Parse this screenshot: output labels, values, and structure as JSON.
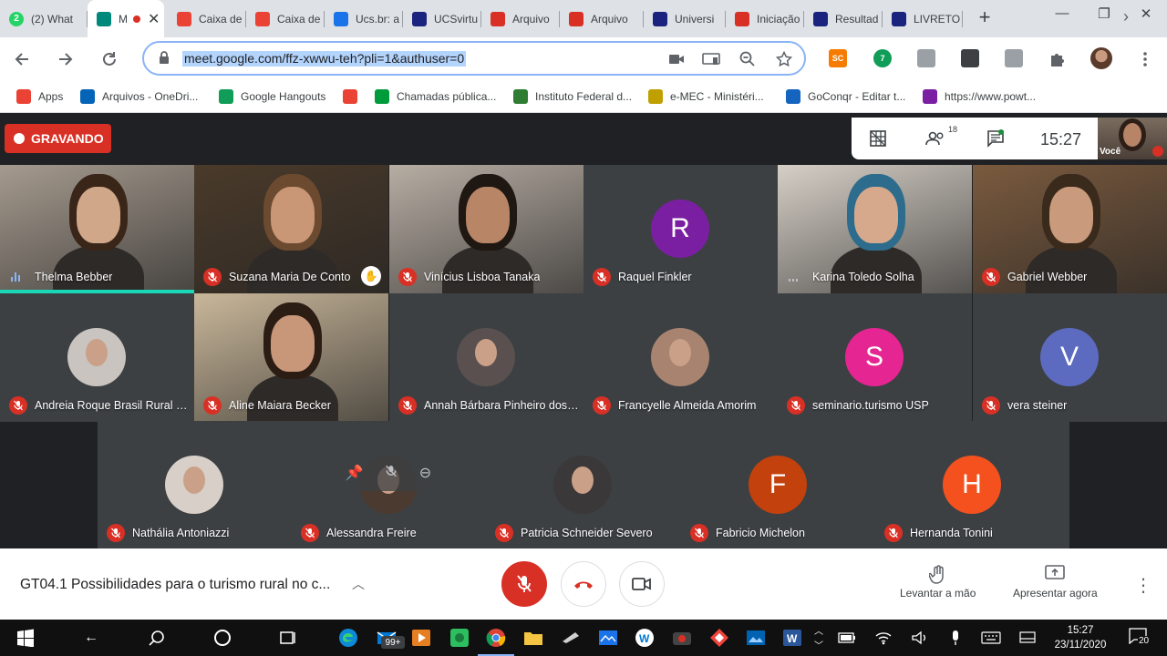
{
  "browser": {
    "tabs": [
      {
        "title": "(2) What",
        "icon": "whatsapp-icon",
        "color": "#25d366",
        "badge": "2"
      },
      {
        "title": "M",
        "icon": "google-meet-icon",
        "color": "#00897b",
        "active": true
      },
      {
        "title": "Caixa de",
        "icon": "gmail-icon",
        "color": "#ea4335"
      },
      {
        "title": "Caixa de",
        "icon": "gmail-icon",
        "color": "#ea4335"
      },
      {
        "title": "Ucs.br: a",
        "icon": "calendar-icon",
        "color": "#1a73e8"
      },
      {
        "title": "UCSvirtu",
        "icon": "university-icon",
        "color": "#1a237e"
      },
      {
        "title": "Arquivo",
        "icon": "settings-icon",
        "color": "#d93025"
      },
      {
        "title": "Arquivo",
        "icon": "settings-icon",
        "color": "#d93025"
      },
      {
        "title": "Universi",
        "icon": "university-icon",
        "color": "#1a237e"
      },
      {
        "title": "Iniciação",
        "icon": "settings-icon",
        "color": "#d93025"
      },
      {
        "title": "Resultad",
        "icon": "university-icon",
        "color": "#1a237e"
      },
      {
        "title": "LIVRETO",
        "icon": "university-icon",
        "color": "#1a237e"
      }
    ],
    "url": "meet.google.com/ffz-xwwu-teh?pli=1&authuser=0",
    "extensions": [
      {
        "name": "sc-extension-icon",
        "label": "SC",
        "color": "#f57c00"
      },
      {
        "name": "extension-badge-icon",
        "label": "7",
        "color": "#0f9d58"
      },
      {
        "name": "shield-extension-icon",
        "label": "",
        "color": "#9aa0a6"
      },
      {
        "name": "grid-extension-icon",
        "label": "",
        "color": "#3c4043"
      },
      {
        "name": "tab-extension-icon",
        "label": "",
        "color": "#9aa0a6"
      }
    ],
    "bookmarks": [
      {
        "label": "Apps",
        "icon": "apps-grid-icon",
        "color": "#ea4335"
      },
      {
        "label": "Arquivos - OneDri...",
        "icon": "onedrive-icon",
        "color": "#0364b8"
      },
      {
        "label": "Google Hangouts",
        "icon": "hangouts-icon",
        "color": "#0f9d58"
      },
      {
        "label": "",
        "icon": "gmail-icon",
        "color": "#ea4335"
      },
      {
        "label": "Chamadas pública...",
        "icon": "flag-icon",
        "color": "#009c3b"
      },
      {
        "label": "Instituto Federal d...",
        "icon": "if-logo-icon",
        "color": "#2e7d32"
      },
      {
        "label": "e-MEC - Ministéri...",
        "icon": "emec-icon",
        "color": "#c0a000"
      },
      {
        "label": "GoConqr - Editar t...",
        "icon": "goconqr-icon",
        "color": "#1565c0"
      },
      {
        "label": "https://www.powt...",
        "icon": "powtoon-icon",
        "color": "#7b1fa2"
      }
    ]
  },
  "meet": {
    "recording_label": "GRAVANDO",
    "participant_count": "18",
    "time": "15:27",
    "self_label": "Você",
    "participants": [
      {
        "name": "Thelma Bebber",
        "kind": "video",
        "muted": false,
        "speaking": true,
        "bg": "#a59a8e",
        "skin": "#d1a78a",
        "hair": "#3a2619"
      },
      {
        "name": "Suzana Maria De Conto",
        "kind": "video",
        "muted": true,
        "bg": "#4a3a2a",
        "skin": "#c99676",
        "hair": "#6b4a30",
        "raised": true
      },
      {
        "name": "Vinícius Lisboa Tanaka",
        "kind": "video",
        "muted": true,
        "bg": "#b7ada3",
        "skin": "#b88566",
        "hair": "#1e1712"
      },
      {
        "name": "Raquel Finkler",
        "kind": "avatar",
        "muted": true,
        "initial": "R",
        "color": "#7b1fa2"
      },
      {
        "name": "Karina Toledo Solha",
        "kind": "video",
        "muted": false,
        "bg": "#d6cfc6",
        "skin": "#d7a98c",
        "hair": "#2d6c8c"
      },
      {
        "name": "Gabriel Webber",
        "kind": "video",
        "muted": true,
        "bg": "#7a5a3e",
        "skin": "#c99a7b",
        "hair": "#3a2a1c"
      },
      {
        "name": "Andreia Roque Brasil Rural E...",
        "kind": "photo",
        "muted": true,
        "photo": "#c9c4c0"
      },
      {
        "name": "Aline Maiara Becker",
        "kind": "video",
        "muted": true,
        "bg": "#c9b79a",
        "skin": "#c8977a",
        "hair": "#2c1d14"
      },
      {
        "name": "Annah Bárbara Pinheiro dos ...",
        "kind": "photo",
        "muted": true,
        "photo": "#5a5050"
      },
      {
        "name": "Francyelle Almeida Amorim",
        "kind": "photo",
        "muted": true,
        "photo": "#a88470"
      },
      {
        "name": "seminario.turismo USP",
        "kind": "avatar",
        "muted": true,
        "initial": "S",
        "color": "#e52592"
      },
      {
        "name": "vera steiner",
        "kind": "avatar",
        "muted": true,
        "initial": "V",
        "color": "#5c6bc0"
      },
      {
        "name": "Nathália Antoniazzi",
        "kind": "photo",
        "muted": true,
        "photo": "#d8d0c8"
      },
      {
        "name": "Alessandra Freire",
        "kind": "photo",
        "muted": true,
        "photo": "#4a3a30",
        "hover": true
      },
      {
        "name": "Patricia Schneider Severo",
        "kind": "photo",
        "muted": true,
        "photo": "#3a3838"
      },
      {
        "name": "Fabricio Michelon",
        "kind": "avatar",
        "muted": true,
        "initial": "F",
        "color": "#c2410c"
      },
      {
        "name": "Hernanda Tonini",
        "kind": "avatar",
        "muted": true,
        "initial": "H",
        "color": "#f4511e"
      }
    ],
    "meeting_title": "GT04.1 Possibilidades para o turismo rural no c...",
    "raise_hand_label": "Levantar a mão",
    "present_label": "Apresentar agora"
  },
  "taskbar": {
    "time": "15:27",
    "date": "23/11/2020",
    "mail_badge": "99+",
    "notifications": "20"
  }
}
